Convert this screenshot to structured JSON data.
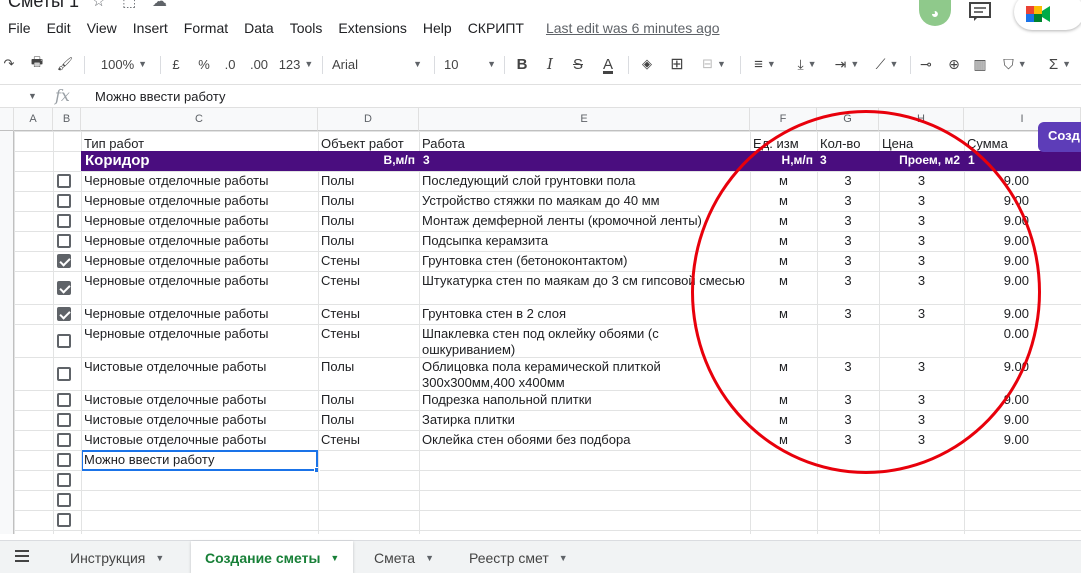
{
  "document": {
    "title": "Сметы 1",
    "last_edit": "Last edit was 6 minutes ago"
  },
  "menu": [
    "File",
    "Edit",
    "View",
    "Insert",
    "Format",
    "Data",
    "Tools",
    "Extensions",
    "Help",
    "СКРИПТ"
  ],
  "toolbar": {
    "zoom": "100%",
    "currency": "£",
    "percent": "%",
    "decrease_decimal": ".0",
    "increase_decimal": ".00",
    "number_format": "123",
    "font": "Arial",
    "font_size": "10",
    "bold": "B",
    "italic": "I",
    "strikethrough": "S",
    "text_color": "A"
  },
  "formula_bar": {
    "fx": "fx",
    "value": "Можно ввести работу"
  },
  "columns": [
    "A",
    "B",
    "C",
    "D",
    "E",
    "F",
    "G",
    "H",
    "I"
  ],
  "header_row": {
    "type": "Тип работ",
    "object": "Объект работ",
    "work": "Работа",
    "unit": "Ед. изм",
    "qty": "Кол-во",
    "price": "Цена",
    "sum": "Сумма"
  },
  "section": {
    "name": "Коридор",
    "d_label": "В,м/п",
    "e_value": "3",
    "f_label": "Н,м/п",
    "g_value": "3",
    "h_label": "Проем, м2",
    "i_value": "1"
  },
  "create_button": "Созд",
  "rows": [
    {
      "checked": false,
      "type": "Черновые отделочные работы",
      "object": "Полы",
      "work": "Последующий слой грунтовки пола",
      "unit": "м",
      "qty": "3",
      "price": "3",
      "sum": "9.00"
    },
    {
      "checked": false,
      "type": "Черновые отделочные работы",
      "object": "Полы",
      "work": "Устройство стяжки по маякам до 40 мм",
      "unit": "м",
      "qty": "3",
      "price": "3",
      "sum": "9.00"
    },
    {
      "checked": false,
      "type": "Черновые отделочные работы",
      "object": "Полы",
      "work": "Монтаж демферной ленты (кромочной ленты)",
      "unit": "м",
      "qty": "3",
      "price": "3",
      "sum": "9.00"
    },
    {
      "checked": false,
      "type": "Черновые отделочные работы",
      "object": "Полы",
      "work": "Подсыпка керамзита",
      "unit": "м",
      "qty": "3",
      "price": "3",
      "sum": "9.00"
    },
    {
      "checked": true,
      "type": "Черновые отделочные работы",
      "object": "Стены",
      "work": "Грунтовка стен (бетоноконтактом)",
      "unit": "м",
      "qty": "3",
      "price": "3",
      "sum": "9.00"
    },
    {
      "checked": true,
      "type": "Черновые отделочные работы",
      "object": "Стены",
      "work": "Штукатурка стен по маякам до 3 см гипсовой смесью",
      "unit": "м",
      "qty": "3",
      "price": "3",
      "sum": "9.00"
    },
    {
      "checked": true,
      "type": "Черновые отделочные работы",
      "object": "Стены",
      "work": "Грунтовка стен в 2 слоя",
      "unit": "м",
      "qty": "3",
      "price": "3",
      "sum": "9.00"
    },
    {
      "checked": false,
      "type": "Черновые отделочные работы",
      "object": "Стены",
      "work": "Шпаклевка стен под оклейку обоями (с ошкуриванием)",
      "unit": "",
      "qty": "",
      "price": "",
      "sum": "0.00"
    },
    {
      "checked": false,
      "type": "Чистовые отделочные работы",
      "object": "Полы",
      "work": "Облицовка пола керамической плиткой 300х300мм,400 х400мм",
      "unit": "м",
      "qty": "3",
      "price": "3",
      "sum": "9.00"
    },
    {
      "checked": false,
      "type": "Чистовые отделочные работы",
      "object": "Полы",
      "work": "Подрезка напольной плитки",
      "unit": "м",
      "qty": "3",
      "price": "3",
      "sum": "9.00"
    },
    {
      "checked": false,
      "type": "Чистовые отделочные работы",
      "object": "Полы",
      "work": "Затирка плитки",
      "unit": "м",
      "qty": "3",
      "price": "3",
      "sum": "9.00"
    },
    {
      "checked": false,
      "type": "Чистовые отделочные работы",
      "object": "Стены",
      "work": "Оклейка стен обоями без подбора",
      "unit": "м",
      "qty": "3",
      "price": "3",
      "sum": "9.00"
    },
    {
      "checked": false,
      "type": "Можно ввести работу",
      "object": "",
      "work": "",
      "unit": "",
      "qty": "",
      "price": "",
      "sum": ""
    },
    {
      "checked": false,
      "type": "",
      "object": "",
      "work": "",
      "unit": "",
      "qty": "",
      "price": "",
      "sum": ""
    },
    {
      "checked": false,
      "type": "",
      "object": "",
      "work": "",
      "unit": "",
      "qty": "",
      "price": "",
      "sum": ""
    },
    {
      "checked": false,
      "type": "",
      "object": "",
      "work": "",
      "unit": "",
      "qty": "",
      "price": "",
      "sum": ""
    }
  ],
  "sheet_tabs": [
    {
      "label": "Инструкция",
      "active": false
    },
    {
      "label": "Создание сметы",
      "active": true
    },
    {
      "label": "Смета",
      "active": false
    },
    {
      "label": "Реестр смет",
      "active": false
    }
  ],
  "colors": {
    "section_band": "#4a0d7f",
    "annotation_circle": "#e8000b",
    "active_tab": "#188038",
    "selection": "#1a73e8"
  }
}
